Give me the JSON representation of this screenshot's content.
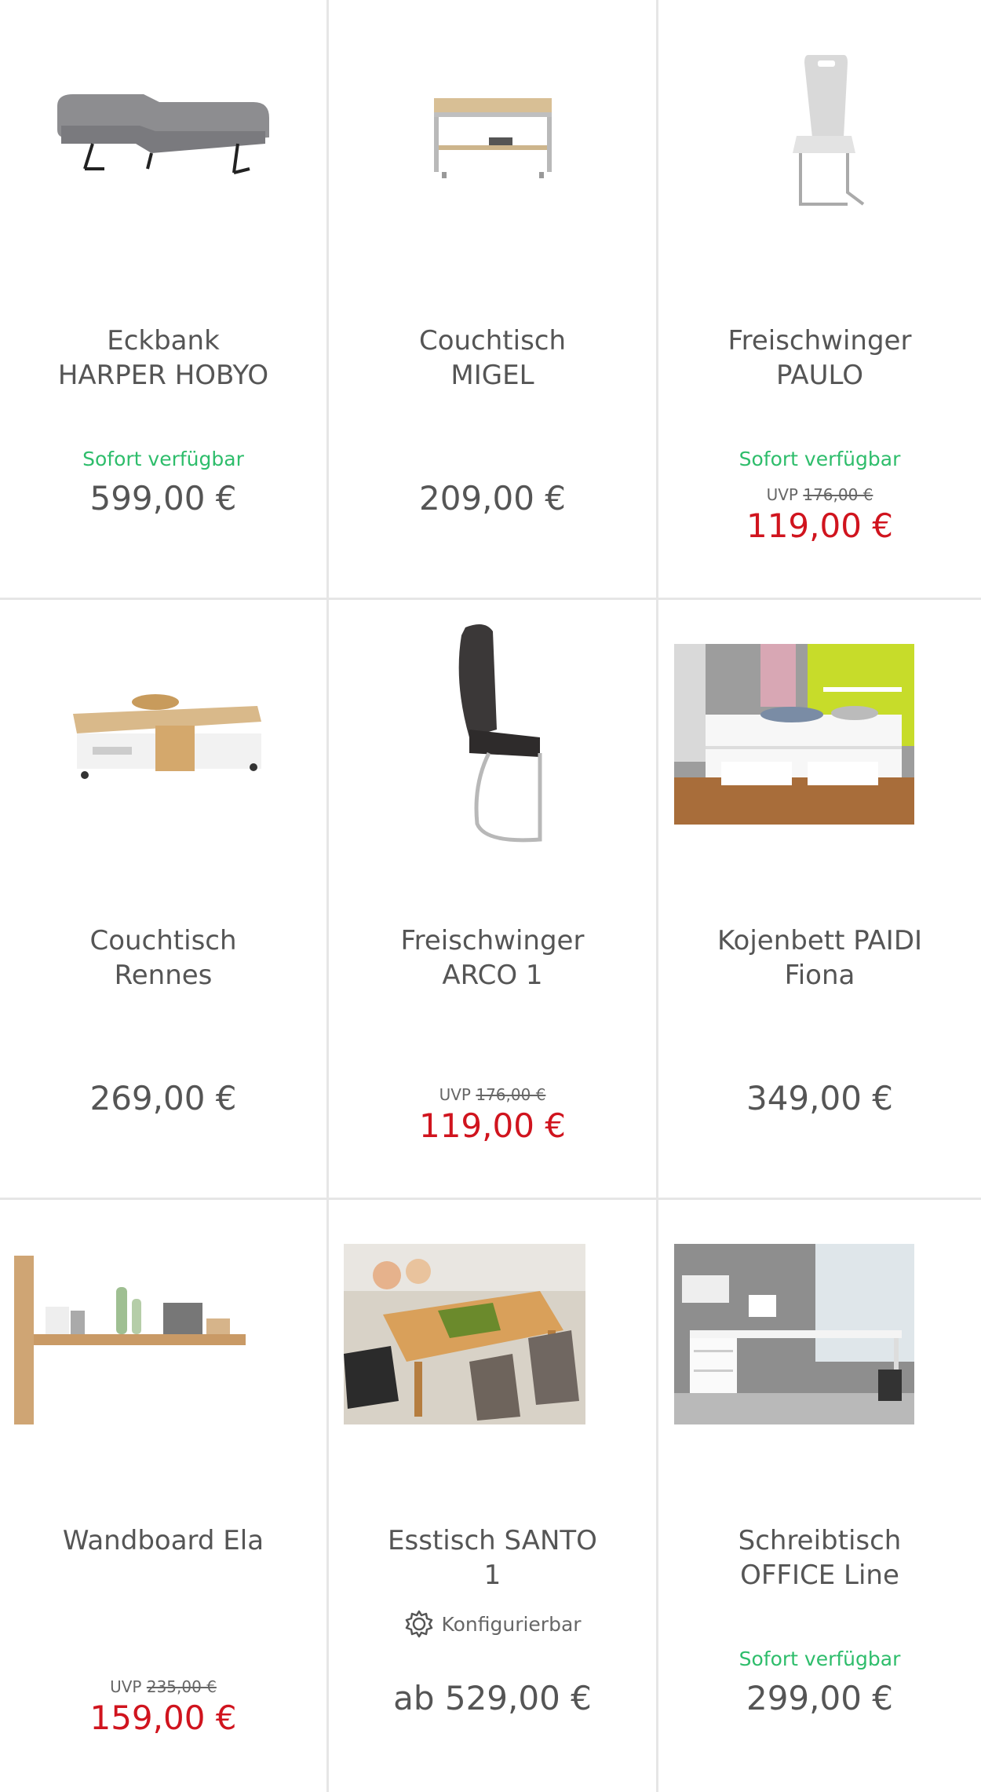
{
  "products": [
    {
      "id": "eckbank",
      "title_line1": "Eckbank",
      "title_line2": "HARPER HOBYO",
      "availability": "Sofort verfügbar",
      "uvp_label": "",
      "uvp_old": "",
      "price": "599,00 €",
      "sale": false
    },
    {
      "id": "couchtisch-migel",
      "title_line1": "Couchtisch",
      "title_line2": "MIGEL",
      "availability": "",
      "uvp_label": "",
      "uvp_old": "",
      "price": "209,00 €",
      "sale": false
    },
    {
      "id": "freischwinger-paulo",
      "title_line1": "Freischwinger",
      "title_line2": "PAULO",
      "availability": "Sofort verfügbar",
      "uvp_label": "UVP",
      "uvp_old": "176,00 €",
      "price": "119,00 €",
      "sale": true
    },
    {
      "id": "couchtisch-rennes",
      "title_line1": "Couchtisch",
      "title_line2": "Rennes",
      "availability": "",
      "uvp_label": "",
      "uvp_old": "",
      "price": "269,00 €",
      "sale": false
    },
    {
      "id": "freischwinger-arco",
      "title_line1": "Freischwinger",
      "title_line2": "ARCO 1",
      "availability": "",
      "uvp_label": "UVP",
      "uvp_old": "176,00 €",
      "price": "119,00 €",
      "sale": true
    },
    {
      "id": "kojenbett-paidi",
      "title_line1": "Kojenbett PAIDI",
      "title_line2": "Fiona",
      "availability": "",
      "uvp_label": "",
      "uvp_old": "",
      "price": "349,00 €",
      "sale": false
    },
    {
      "id": "wandboard-ela",
      "title_line1": "Wandboard Ela",
      "title_line2": "",
      "availability": "",
      "uvp_label": "UVP",
      "uvp_old": "235,00 €",
      "price": "159,00 €",
      "sale": true
    },
    {
      "id": "esstisch-santo",
      "title_line1": "Esstisch SANTO",
      "title_line2": "1",
      "availability": "",
      "uvp_label": "",
      "uvp_old": "",
      "price": "ab 529,00 €",
      "sale": false,
      "config_label": "Konfigurierbar",
      "config_icon": "gear-icon"
    },
    {
      "id": "schreibtisch-office",
      "title_line1": "Schreibtisch",
      "title_line2": "OFFICE Line",
      "availability": "Sofort verfügbar",
      "uvp_label": "",
      "uvp_old": "",
      "price": "299,00 €",
      "sale": false
    }
  ],
  "colors": {
    "available": "#2ebd6b",
    "sale": "#d0141e",
    "text": "#555555",
    "divider": "#e6e6e6"
  }
}
